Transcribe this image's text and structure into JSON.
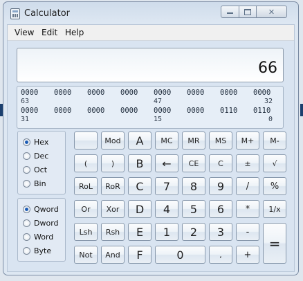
{
  "window": {
    "title": "Calculator"
  },
  "menu": [
    "View",
    "Edit",
    "Help"
  ],
  "display": {
    "value": "66"
  },
  "bits": {
    "row1": [
      "0000",
      "0000",
      "0000",
      "0000",
      "0000",
      "0000",
      "0000",
      "0000"
    ],
    "row1_labels": [
      "63",
      "47",
      "32"
    ],
    "row2": [
      "0000",
      "0000",
      "0000",
      "0000",
      "0000",
      "0000",
      "0110",
      "0110"
    ],
    "row2_labels": [
      "31",
      "15",
      "0"
    ]
  },
  "number_system": {
    "options": [
      "Hex",
      "Dec",
      "Oct",
      "Bin"
    ],
    "selected": "Hex"
  },
  "word_size": {
    "options": [
      "Qword",
      "Dword",
      "Word",
      "Byte"
    ],
    "selected": "Qword"
  },
  "keys": {
    "mod": "Mod",
    "a": "A",
    "mc": "MC",
    "mr": "MR",
    "ms": "MS",
    "mplus": "M+",
    "mminus": "M-",
    "lparen": "(",
    "rparen": ")",
    "b": "B",
    "backspace": "←",
    "ce": "CE",
    "c": "C",
    "plusminus": "±",
    "sqrt": "√",
    "rol": "RoL",
    "ror": "RoR",
    "kc": "C",
    "d7": "7",
    "d8": "8",
    "d9": "9",
    "div": "/",
    "percent": "%",
    "or": "Or",
    "xor": "Xor",
    "d": "D",
    "d4": "4",
    "d5": "5",
    "d6": "6",
    "mul": "*",
    "recip": "1/x",
    "lsh": "Lsh",
    "rsh": "Rsh",
    "e": "E",
    "d1": "1",
    "d2": "2",
    "d3": "3",
    "sub": "-",
    "equals": "=",
    "not": "Not",
    "and": "And",
    "f": "F",
    "d0": "0",
    "dot": ",",
    "add": "+"
  }
}
